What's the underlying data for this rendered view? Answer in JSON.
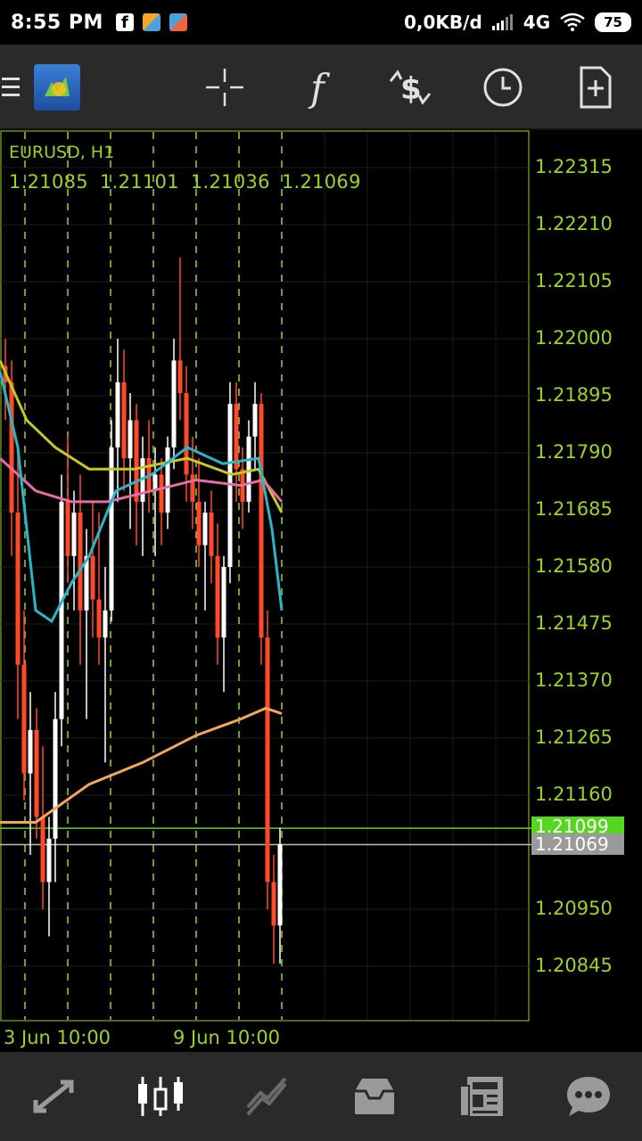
{
  "statusbar": {
    "time": "8:55 PM",
    "network": "0,0KB/d",
    "signal": "4G",
    "battery": "75"
  },
  "toolbar": {
    "items": [
      "menu-icon",
      "app-logo",
      "crosshair-icon",
      "indicators-icon",
      "trade-icon",
      "timeframe-icon",
      "new-order-icon"
    ]
  },
  "chart": {
    "symbol": "EURUSD, H1",
    "ohlc": [
      "1.21085",
      "1.21101",
      "1.21036",
      "1.21069"
    ],
    "price_scale": [
      "1.22315",
      "1.22210",
      "1.22105",
      "1.22000",
      "1.21895",
      "1.21790",
      "1.21685",
      "1.21580",
      "1.21475",
      "1.21370",
      "1.21265",
      "1.21160",
      "1.20950",
      "1.20845"
    ],
    "bid_price": "1.21099",
    "ask_price": "1.21069",
    "date_labels": [
      "3 Jun 10:00",
      "9 Jun 10:00"
    ],
    "colors": {
      "grid": "#9dd41f",
      "bull": "#ffffff",
      "bear": "#ff4a2a",
      "ma_yellow": "#c8c81e",
      "ma_pink": "#e86aa8",
      "ma_cyan": "#29b6c8",
      "ma_orange": "#f5a65b"
    }
  },
  "bottomnav": {
    "items": [
      "quotes-icon",
      "chart-icon",
      "trade-icon",
      "history-icon",
      "news-icon",
      "messages-icon"
    ],
    "active": "chart-icon"
  }
}
